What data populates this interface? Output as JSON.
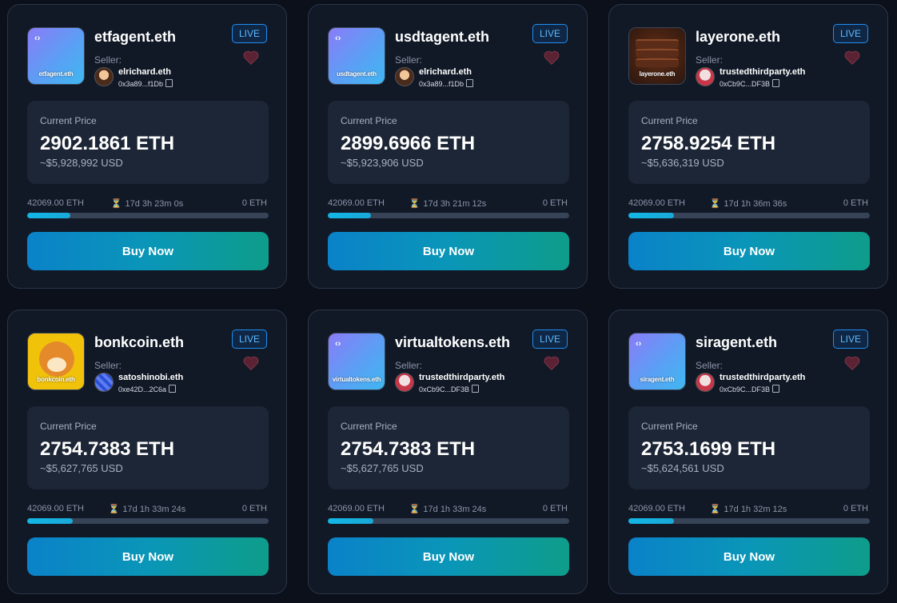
{
  "cards": [
    {
      "name": "etfagent.eth",
      "thumb_label": "etfagent.eth",
      "thumb_style": "gradient",
      "status": "LIVE",
      "seller_label": "Seller:",
      "seller_name": "elrichard.eth",
      "seller_address": "0x3a89...f1Db",
      "price_label": "Current Price",
      "price_eth": "2902.1861 ETH",
      "price_usd": "~$5,928,992 USD",
      "start_price": "42069.00 ETH",
      "time_left": "17d 3h 23m 0s",
      "end_price": "0 ETH",
      "progress": 0.18,
      "buy_label": "Buy Now"
    },
    {
      "name": "usdtagent.eth",
      "thumb_label": "usdtagent.eth",
      "thumb_style": "gradient",
      "status": "LIVE",
      "seller_label": "Seller:",
      "seller_name": "elrichard.eth",
      "seller_address": "0x3a89...f1Db",
      "price_label": "Current Price",
      "price_eth": "2899.6966 ETH",
      "price_usd": "~$5,923,906 USD",
      "start_price": "42069.00 ETH",
      "time_left": "17d 3h 21m 12s",
      "end_price": "0 ETH",
      "progress": 0.18,
      "buy_label": "Buy Now"
    },
    {
      "name": "layerone.eth",
      "thumb_label": "layerone.eth",
      "thumb_style": "cake",
      "status": "LIVE",
      "seller_label": "Seller:",
      "seller_name": "trustedthirdparty.eth",
      "seller_address": "0xCb9C...DF3B",
      "price_label": "Current Price",
      "price_eth": "2758.9254 ETH",
      "price_usd": "~$5,636,319 USD",
      "start_price": "42069.00 ETH",
      "time_left": "17d 1h 36m 36s",
      "end_price": "0 ETH",
      "progress": 0.19,
      "buy_label": "Buy Now"
    },
    {
      "name": "bonkcoin.eth",
      "thumb_label": "bonkcoin.eth",
      "thumb_style": "dog",
      "status": "LIVE",
      "seller_label": "Seller:",
      "seller_name": "satoshinobi.eth",
      "seller_address": "0xe42D...2C6a",
      "price_label": "Current Price",
      "price_eth": "2754.7383 ETH",
      "price_usd": "~$5,627,765 USD",
      "start_price": "42069.00 ETH",
      "time_left": "17d 1h 33m 24s",
      "end_price": "0 ETH",
      "progress": 0.19,
      "buy_label": "Buy Now"
    },
    {
      "name": "virtualtokens.eth",
      "thumb_label": "virtualtokens.eth",
      "thumb_style": "gradient",
      "status": "LIVE",
      "seller_label": "Seller:",
      "seller_name": "trustedthirdparty.eth",
      "seller_address": "0xCb9C...DF3B",
      "price_label": "Current Price",
      "price_eth": "2754.7383 ETH",
      "price_usd": "~$5,627,765 USD",
      "start_price": "42069.00 ETH",
      "time_left": "17d 1h 33m 24s",
      "end_price": "0 ETH",
      "progress": 0.19,
      "buy_label": "Buy Now"
    },
    {
      "name": "siragent.eth",
      "thumb_label": "siragent.eth",
      "thumb_style": "gradient",
      "status": "LIVE",
      "seller_label": "Seller:",
      "seller_name": "trustedthirdparty.eth",
      "seller_address": "0xCb9C...DF3B",
      "price_label": "Current Price",
      "price_eth": "2753.1699 ETH",
      "price_usd": "~$5,624,561 USD",
      "start_price": "42069.00 ETH",
      "time_left": "17d 1h 32m 12s",
      "end_price": "0 ETH",
      "progress": 0.19,
      "buy_label": "Buy Now"
    }
  ],
  "colors": {
    "background": "#0b101a",
    "card": "#111927",
    "live_border": "#1f8ef0",
    "button_start": "#0a82c9",
    "button_end": "#0e9d8a",
    "progress_fill": "#12b7e6"
  },
  "icons": {
    "favorite": "heart-icon",
    "timer": "hourglass-icon",
    "copy": "copy-icon"
  }
}
